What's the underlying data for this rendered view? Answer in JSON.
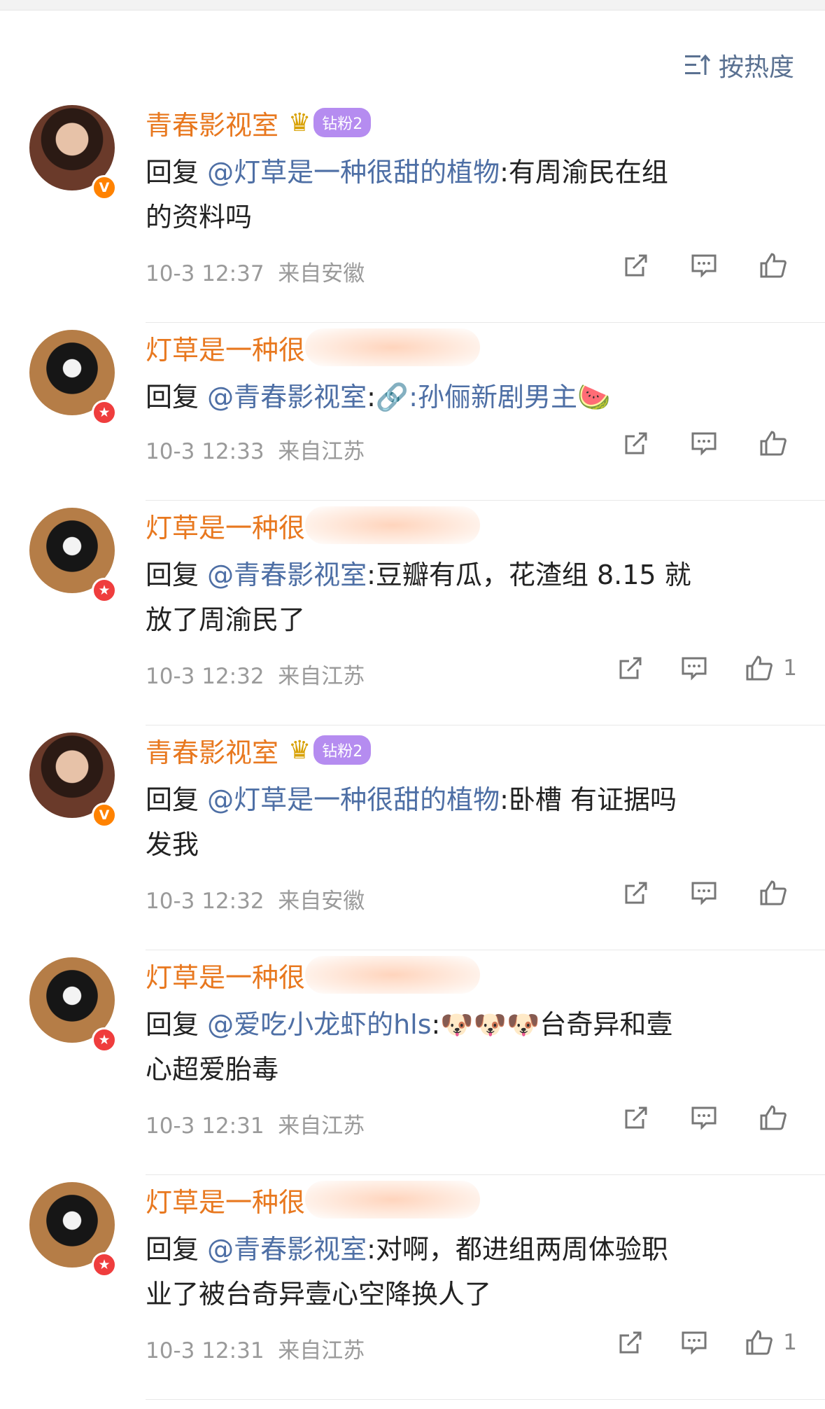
{
  "sort": {
    "label": "按热度"
  },
  "comments": [
    {
      "name": "青春影视室",
      "fan_badge": "钻粉2",
      "prefix": "回复 ",
      "mention": "@灯草是一种很甜的植物",
      "line": ":有周渝民在组",
      "line2": "的资料吗",
      "time": "10-3 12:37",
      "loc": "来自安徽",
      "likes": ""
    },
    {
      "name": "灯草是一种很",
      "prefix": "回复 ",
      "mention": "@青春影视室",
      "line": ":孙俪新剧男主",
      "emoji": "🍉",
      "time": "10-3 12:33",
      "loc": "来自江苏",
      "likes": ""
    },
    {
      "name": "灯草是一种很",
      "prefix": "回复 ",
      "mention": "@青春影视室",
      "line": ":豆瓣有瓜，花渣组 8.15 就",
      "line2": "放了周渝民了",
      "time": "10-3 12:32",
      "loc": "来自江苏",
      "likes": "1"
    },
    {
      "name": "青春影视室",
      "fan_badge": "钻粉2",
      "prefix": "回复 ",
      "mention": "@灯草是一种很甜的植物",
      "line": ":卧槽 有证据吗",
      "line2": "发我",
      "time": "10-3 12:32",
      "loc": "来自安徽",
      "likes": ""
    },
    {
      "name": "灯草是一种很",
      "prefix": "回复 ",
      "mention": "@爱吃小龙虾的hls",
      "line": ":",
      "emoji": "🐶🐶🐶",
      "line_after": "台奇异和壹",
      "line2": "心超爱胎毒",
      "time": "10-3 12:31",
      "loc": "来自江苏",
      "likes": ""
    },
    {
      "name": "灯草是一种很",
      "prefix": "回复 ",
      "mention": "@青春影视室",
      "line": ":对啊，都进组两周体验职",
      "line2": "业了被台奇异壹心空降换人了",
      "time": "10-3 12:31",
      "loc": "来自江苏",
      "likes": "1"
    }
  ]
}
